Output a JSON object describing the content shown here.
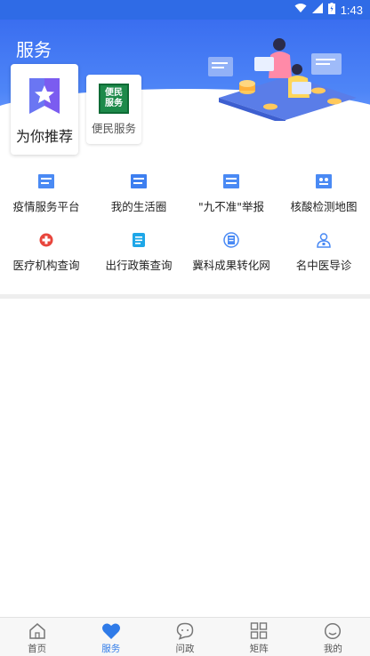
{
  "status_bar": {
    "time": "1:43",
    "icons": [
      "wifi-icon",
      "signal-icon",
      "battery-icon"
    ]
  },
  "page": {
    "title": "服务"
  },
  "tabs": [
    {
      "label": "为你推荐",
      "icon": "star-bookmark-icon",
      "active": true
    },
    {
      "label": "便民服务",
      "icon_text_line1": "便民",
      "icon_text_line2": "服务",
      "icon": "green-sign-icon",
      "active": false
    }
  ],
  "services": {
    "row1": [
      {
        "label": "疫情服务平台",
        "icon": "epidemic-platform-icon"
      },
      {
        "label": "我的生活圈",
        "icon": "life-circle-icon"
      },
      {
        "label": "\"九不准\"举报",
        "icon": "report-icon"
      },
      {
        "label": "核酸检测地图",
        "icon": "nucleic-map-icon"
      }
    ],
    "row2": [
      {
        "label": "医疗机构查询",
        "icon": "medical-cross-icon"
      },
      {
        "label": "出行政策查询",
        "icon": "document-icon"
      },
      {
        "label": "冀科成果转化网",
        "icon": "tech-transfer-icon"
      },
      {
        "label": "名中医导诊",
        "icon": "doctor-icon"
      }
    ]
  },
  "bottom_nav": [
    {
      "label": "首页",
      "icon": "home-icon"
    },
    {
      "label": "服务",
      "icon": "heart-icon",
      "active": true
    },
    {
      "label": "问政",
      "icon": "chat-icon"
    },
    {
      "label": "矩阵",
      "icon": "grid-icon"
    },
    {
      "label": "我的",
      "icon": "profile-icon"
    }
  ],
  "colors": {
    "primary": "#2f6be6",
    "accent": "#2f7be8",
    "badge_purple": "#7b5cf0",
    "green_sign": "#1d8a4a",
    "red": "#e8453c"
  }
}
